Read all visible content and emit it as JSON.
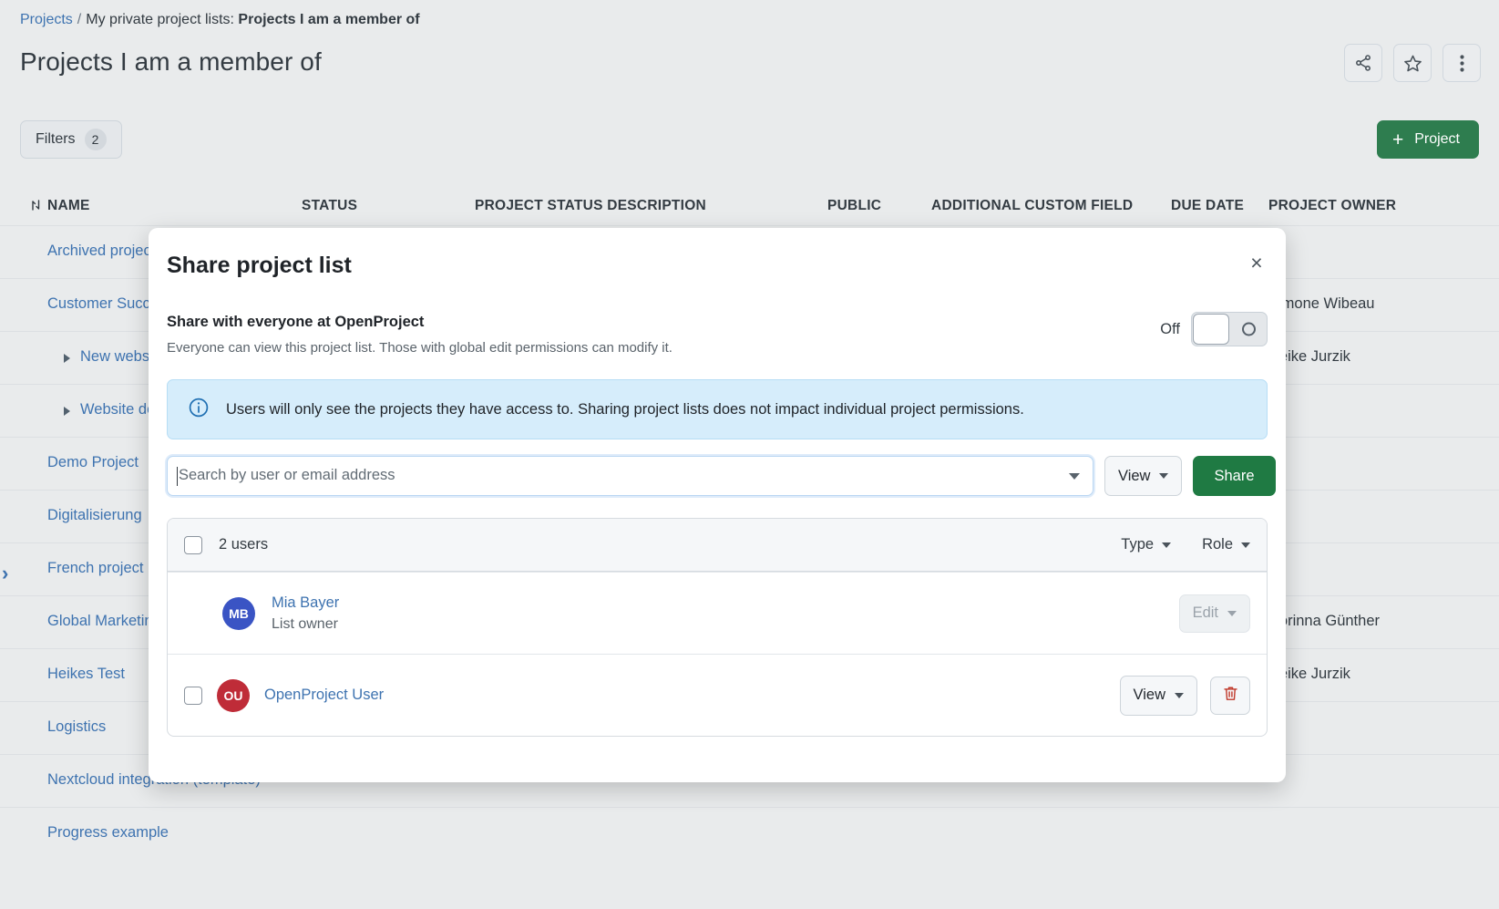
{
  "breadcrumb": {
    "root": "Projects",
    "separator": "/",
    "trail_prefix": "My private project lists:",
    "current": "Projects I am a member of"
  },
  "page_title": "Projects I am a member of",
  "header_actions": [
    {
      "name": "share-icon",
      "label": "Share"
    },
    {
      "name": "star-icon",
      "label": "Favorite"
    },
    {
      "name": "kebab-menu-icon",
      "label": "More"
    }
  ],
  "toolbar": {
    "filters_label": "Filters",
    "filters_count": "2",
    "project_button_label": "Project",
    "project_button_plus": "+",
    "project_button_color": "#2E7D4F"
  },
  "table": {
    "columns": [
      "NAME",
      "STATUS",
      "PROJECT STATUS DESCRIPTION",
      "PUBLIC",
      "ADDITIONAL CUSTOM FIELD",
      "DUE DATE",
      "PROJECT OWNER"
    ],
    "rows": [
      {
        "name": "Archived project",
        "owner": "",
        "indent": false,
        "expandable": false
      },
      {
        "name": "Customer Success",
        "owner": "Simone Wibeau",
        "indent": false,
        "expandable": false
      },
      {
        "name": "New website",
        "owner": "Heike Jurzik",
        "indent": true,
        "expandable": true
      },
      {
        "name": "Website design",
        "owner": "",
        "indent": true,
        "expandable": true
      },
      {
        "name": "Demo Project",
        "owner": "",
        "indent": false,
        "expandable": false
      },
      {
        "name": "Digitalisierung",
        "owner": "",
        "indent": false,
        "expandable": false
      },
      {
        "name": "French project",
        "owner": "",
        "indent": false,
        "expandable": false
      },
      {
        "name": "Global Marketing",
        "owner": "Corinna Günther",
        "indent": false,
        "expandable": false
      },
      {
        "name": "Heikes Test",
        "owner": "Heike Jurzik",
        "indent": false,
        "expandable": false
      },
      {
        "name": "Logistics",
        "owner": "",
        "indent": false,
        "expandable": false
      },
      {
        "name": "Nextcloud integration (template)",
        "owner": "",
        "indent": false,
        "expandable": false
      },
      {
        "name": "Progress example",
        "owner": "",
        "indent": false,
        "expandable": false
      }
    ]
  },
  "modal": {
    "title": "Share project list",
    "close_label": "×",
    "share_all": {
      "heading": "Share with everyone at OpenProject",
      "description": "Everyone can view this project list. Those with global edit permissions can modify it.",
      "toggle_label": "Off",
      "toggle_state": "off"
    },
    "info_banner": {
      "text": "Users will only see the projects they have access to. Sharing project lists does not impact individual project permissions.",
      "background": "#D6EDFB"
    },
    "search": {
      "placeholder": "Search by user or email address",
      "value": "",
      "view_label": "View",
      "share_label": "Share",
      "share_color": "#1F7A43"
    },
    "users_list": {
      "count_label": "2 users",
      "type_label": "Type",
      "role_label": "Role",
      "users": [
        {
          "initials": "MB",
          "avatar_color": "#3A54C4",
          "name": "Mia Bayer",
          "subtitle": "List owner",
          "role_label": "Edit",
          "role_disabled": true,
          "has_checkbox": false,
          "has_delete": false
        },
        {
          "initials": "OU",
          "avatar_color": "#BF2C38",
          "name": "OpenProject User",
          "subtitle": "",
          "role_label": "View",
          "role_disabled": false,
          "has_checkbox": true,
          "has_delete": true
        }
      ]
    }
  }
}
